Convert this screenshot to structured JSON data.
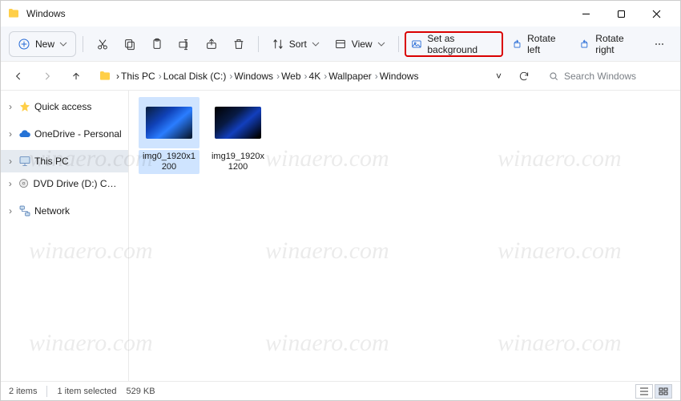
{
  "window": {
    "title": "Windows"
  },
  "toolbar": {
    "new_label": "New",
    "sort_label": "Sort",
    "view_label": "View",
    "set_bg_label": "Set as background",
    "rotate_left_label": "Rotate left",
    "rotate_right_label": "Rotate right"
  },
  "breadcrumb": {
    "items": [
      "This PC",
      "Local Disk (C:)",
      "Windows",
      "Web",
      "4K",
      "Wallpaper",
      "Windows"
    ]
  },
  "search": {
    "placeholder": "Search Windows"
  },
  "sidebar": {
    "items": [
      {
        "label": "Quick access",
        "icon": "star",
        "expander": ">"
      },
      {
        "label": "OneDrive - Personal",
        "icon": "cloud",
        "expander": ">"
      },
      {
        "label": "This PC",
        "icon": "pc",
        "expander": ">",
        "selected": true
      },
      {
        "label": "DVD Drive (D:) CCCO",
        "icon": "disc",
        "expander": ">"
      },
      {
        "label": "Network",
        "icon": "network",
        "expander": ">"
      }
    ]
  },
  "files": [
    {
      "name": "img0_1920x1200",
      "selected": true,
      "dark": false
    },
    {
      "name": "img19_1920x1200",
      "selected": false,
      "dark": true
    }
  ],
  "status": {
    "count": "2 items",
    "selected": "1 item selected",
    "size": "529 KB"
  },
  "watermark": "winaero.com"
}
